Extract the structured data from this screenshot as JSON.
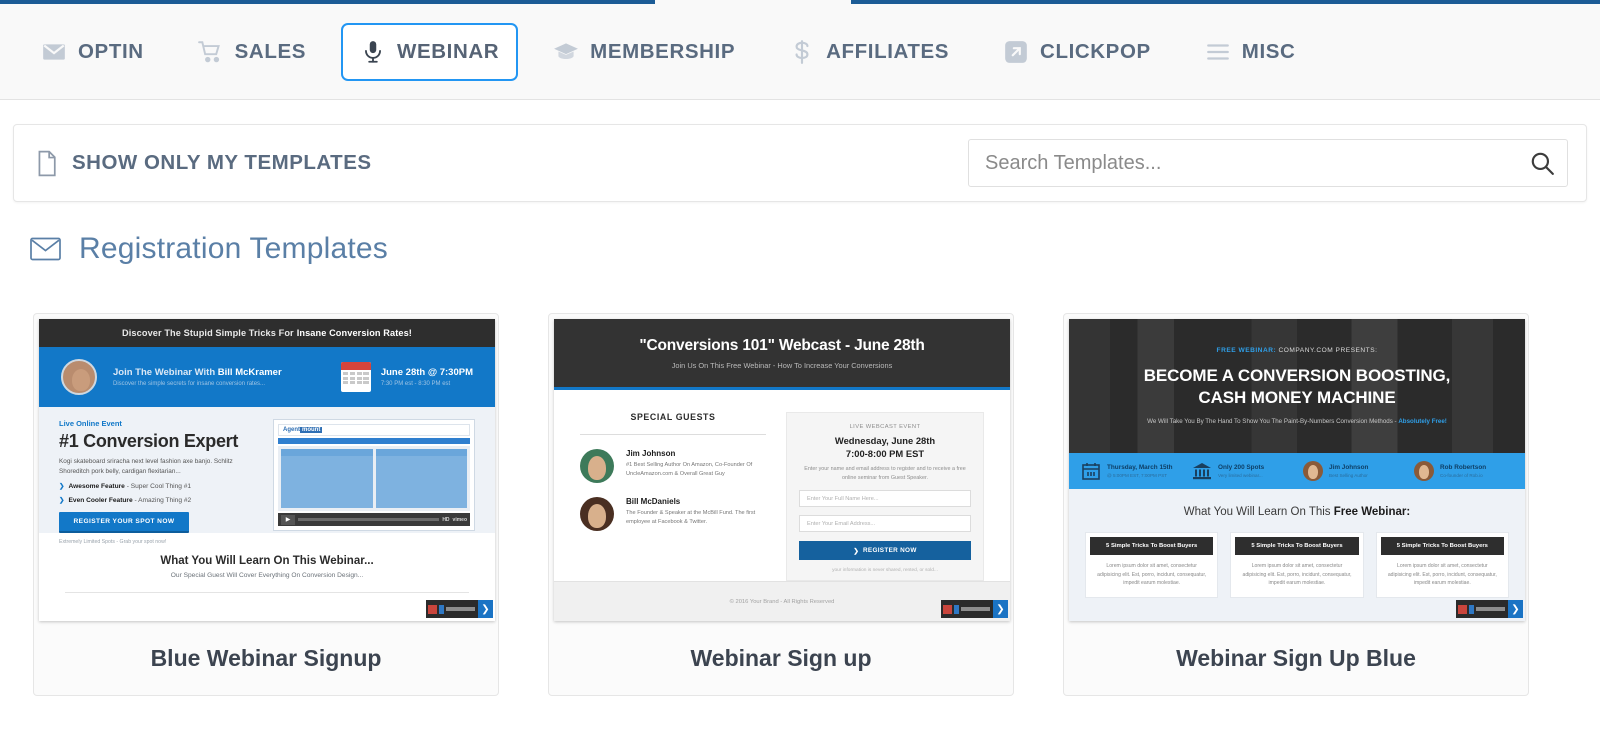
{
  "topbar": {
    "accent_color": "#1c5c96"
  },
  "nav": {
    "items": [
      {
        "label": "OPTIN",
        "icon": "envelope-icon",
        "active": false
      },
      {
        "label": "SALES",
        "icon": "shopping-cart-icon",
        "active": false
      },
      {
        "label": "WEBINAR",
        "icon": "microphone-icon",
        "active": true
      },
      {
        "label": "MEMBERSHIP",
        "icon": "graduation-cap-icon",
        "active": false
      },
      {
        "label": "AFFILIATES",
        "icon": "dollar-sign-icon",
        "active": false
      },
      {
        "label": "CLICKPOP",
        "icon": "popup-arrow-icon",
        "active": false
      },
      {
        "label": "MISC",
        "icon": "hamburger-menu-icon",
        "active": false
      }
    ],
    "active_border_color": "#2296f3"
  },
  "filterbar": {
    "show_only_mine_label": "SHOW ONLY MY TEMPLATES",
    "show_only_mine_icon": "document-icon",
    "search_placeholder": "Search Templates...",
    "search_value": "",
    "search_icon": "search-icon"
  },
  "section": {
    "title": "Registration Templates",
    "icon": "envelope-icon",
    "color": "#5a7fa6"
  },
  "cards": [
    {
      "name": "Blue Webinar Signup",
      "badge": {
        "arrow": "❯"
      },
      "preview": {
        "announce": "Discover The Stupid Simple Tricks For ",
        "announce_bold": "Insane Conversion Rates!",
        "hero_line": "Join The Webinar With ",
        "hero_line_bold": "Bill McKramer",
        "hero_sub": "Discover the simple secrets for insane conversion rates...",
        "date": "June 28th @ 7:30PM",
        "date_sub": "7:30 PM est - 8:30 PM est",
        "kicker": "Live Online Event",
        "headline": "#1 Conversion Expert",
        "paragraph": "Kogi skateboard sriracha next level fashion axe banjo. Schlitz Shoreditch pork belly, cardigan flexitarian...",
        "bullet1_bold": "Awesome Feature",
        "bullet1_rest": " - Super Cool Thing #1",
        "bullet2_bold": "Even Cooler Feature",
        "bullet2_rest": " - Amazing Thing #2",
        "cta": "REGISTER YOUR SPOT NOW",
        "fine_print": "Extremely Limited Spots - Grab your spot now!",
        "video_logo_a": "Agent",
        "video_logo_b": "mount",
        "video_hd": "HD",
        "video_brand": "vimeo",
        "learn_head": "What You Will Learn On This Webinar...",
        "learn_sub": "Our Special Guest Will Cover Everything On Conversion Design..."
      }
    },
    {
      "name": "Webinar Sign up",
      "badge": {
        "arrow": "❯"
      },
      "preview": {
        "headline": "\"Conversions 101\" Webcast - June 28th",
        "subhead": "Join Us On This Free Webinar - How To Increase Your Conversions",
        "guests_label": "SPECIAL GUESTS",
        "guests": [
          {
            "name": "Jim Johnson",
            "desc": "#1 Best Selling Author On Amazon, Co-Founder Of UncleAmazon.com & Overall Great Guy"
          },
          {
            "name": "Bill McDaniels",
            "desc": "The Founder & Speaker at the McBill Fund. The first employee at Facebook & Twitter."
          }
        ],
        "form_kicker": "LIVE WEBCAST EVENT",
        "form_date": "Wednesday, June 28th",
        "form_time": "7:00-8:00 PM EST",
        "form_copy": "Enter your name and email address to register and to receive a free online seminar from Guest Speaker.",
        "input_name": "Enter Your Full Name Here...",
        "input_email": "Enter Your Email Address...",
        "cta": "REGISTER NOW",
        "note": "your information is never shared, rented, or sold...",
        "footer": "© 2016 Your Brand - All Rights Reserved"
      }
    },
    {
      "name": "Webinar Sign Up Blue",
      "badge": {
        "arrow": "❯"
      },
      "preview": {
        "kicker_bold": "FREE WEBINAR:",
        "kicker_rest": " COMPANY.COM PRESENTS:",
        "headline_l1": "BECOME A CONVERSION BOOSTING,",
        "headline_l2": "CASH MONEY MACHINE",
        "subhead": "We Will Take You By The Hand To Show You The Paint-By-Numbers Conversion Methods - ",
        "subhead_bold": "Absolutely Free!",
        "bar_items": [
          {
            "icon": "calendar-icon",
            "title": "Thursday, March 15th",
            "sub": "@ 5:00PM EST, 7:00PM PST"
          },
          {
            "icon": "bank-icon",
            "title": "Only 200 Spots",
            "sub": "Very limited webinar..."
          },
          {
            "icon": "avatar-icon",
            "title": "Jim Johnson",
            "sub": "Best Selling Author"
          },
          {
            "icon": "avatar-icon",
            "title": "Rob Robertson",
            "sub": "Co-founder of Rob.io"
          }
        ],
        "learn_head": "What You Will Learn On This ",
        "learn_head_bold": "Free Webinar:",
        "feature_cards": [
          {
            "title": "5 Simple Tricks To Boost Buyers",
            "body": "Lorem ipsum dolor sit amet, consectetur adipisicing elit. Est, porro, incidunt, consequatur, impedit earum molestiae."
          },
          {
            "title": "5 Simple Tricks To Boost Buyers",
            "body": "Lorem ipsum dolor sit amet, consectetur adipisicing elit. Est, porro, incidunt, consequatur, impedit earum molestiae."
          },
          {
            "title": "5 Simple Tricks To Boost Buyers",
            "body": "Lorem ipsum dolor sit amet, consectetur adipisicing elit. Est, porro, incidunt, consequatur, impedit earum molestiae."
          }
        ]
      }
    }
  ]
}
